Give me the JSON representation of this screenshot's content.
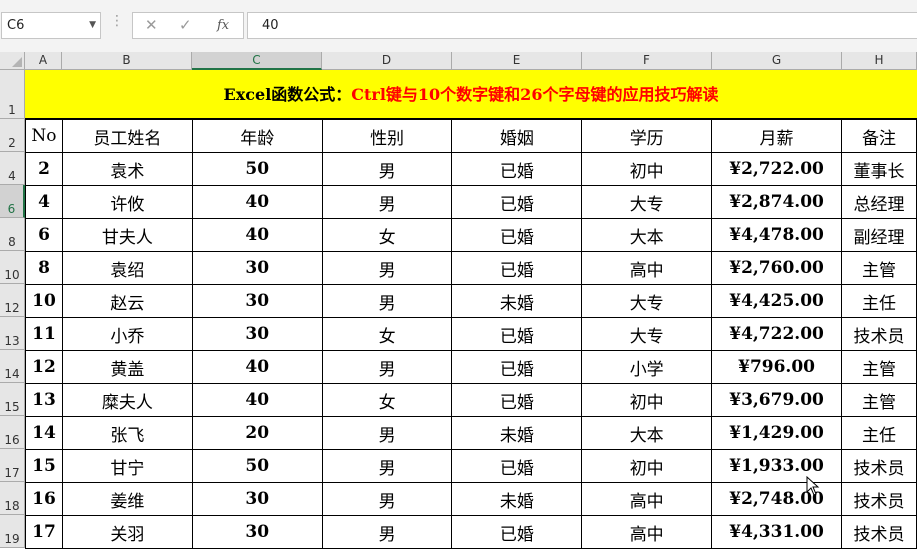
{
  "formula_bar": {
    "name_box": "C6",
    "formula": "40",
    "cancel_icon": "✕",
    "enter_icon": "✓",
    "fx_label": "fx"
  },
  "columns": [
    "A",
    "B",
    "C",
    "D",
    "E",
    "F",
    "G",
    "H"
  ],
  "selected_column": "C",
  "row_numbers": [
    "1",
    "2",
    "4",
    "6",
    "8",
    "10",
    "12",
    "13",
    "14",
    "15",
    "16",
    "17",
    "18",
    "19"
  ],
  "selected_row": "6",
  "title": {
    "part1": "Excel函数公式：",
    "part2": "Ctrl键与10个数字键和26个字母键的应用技巧解读"
  },
  "table": {
    "headers": [
      "No",
      "员工姓名",
      "年龄",
      "性别",
      "婚姻",
      "学历",
      "月薪",
      "备注"
    ],
    "rows": [
      [
        "2",
        "袁术",
        "50",
        "男",
        "已婚",
        "初中",
        "¥2,722.00",
        "董事长"
      ],
      [
        "4",
        "许攸",
        "40",
        "男",
        "已婚",
        "大专",
        "¥2,874.00",
        "总经理"
      ],
      [
        "6",
        "甘夫人",
        "40",
        "女",
        "已婚",
        "大本",
        "¥4,478.00",
        "副经理"
      ],
      [
        "8",
        "袁绍",
        "30",
        "男",
        "已婚",
        "高中",
        "¥2,760.00",
        "主管"
      ],
      [
        "10",
        "赵云",
        "30",
        "男",
        "未婚",
        "大专",
        "¥4,425.00",
        "主任"
      ],
      [
        "11",
        "小乔",
        "30",
        "女",
        "已婚",
        "大专",
        "¥4,722.00",
        "技术员"
      ],
      [
        "12",
        "黄盖",
        "40",
        "男",
        "已婚",
        "小学",
        "¥796.00",
        "主管"
      ],
      [
        "13",
        "糜夫人",
        "40",
        "女",
        "已婚",
        "初中",
        "¥3,679.00",
        "主管"
      ],
      [
        "14",
        "张飞",
        "20",
        "男",
        "未婚",
        "大本",
        "¥1,429.00",
        "主任"
      ],
      [
        "15",
        "甘宁",
        "50",
        "男",
        "已婚",
        "初中",
        "¥1,933.00",
        "技术员"
      ],
      [
        "16",
        "姜维",
        "30",
        "男",
        "未婚",
        "高中",
        "¥2,748.00",
        "技术员"
      ],
      [
        "17",
        "关羽",
        "30",
        "男",
        "已婚",
        "高中",
        "¥4,331.00",
        "技术员"
      ]
    ]
  },
  "colors": {
    "title_bg": "#ffff00",
    "title_highlight": "#ff0000",
    "selection": "#217346"
  }
}
